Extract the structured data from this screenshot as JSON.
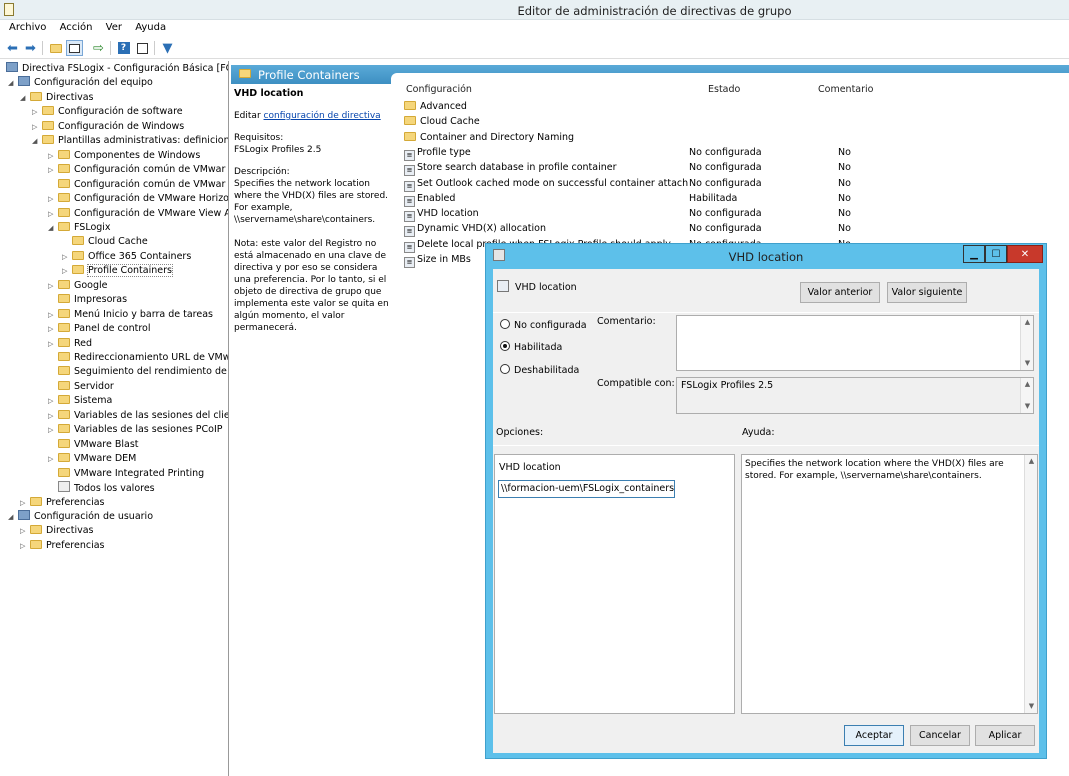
{
  "window": {
    "title": "Editor de administración de directivas de grupo"
  },
  "menu": [
    "Archivo",
    "Acción",
    "Ver",
    "Ayuda"
  ],
  "toolbar_icons": [
    "back-icon",
    "forward-icon",
    "up-folder-icon",
    "show-hide-tree-icon",
    "export-list-icon",
    "help-icon",
    "properties-icon",
    "filter-icon"
  ],
  "tree": [
    {
      "label": "Directiva FSLogix - Configuración Básica [FORM",
      "icon": "policy",
      "level": 0,
      "exp": ""
    },
    {
      "label": "Configuración del equipo",
      "icon": "computer",
      "level": 1,
      "exp": "◢"
    },
    {
      "label": "Directivas",
      "icon": "folder",
      "level": 2,
      "exp": "◢"
    },
    {
      "label": "Configuración de software",
      "icon": "folder",
      "level": 3,
      "exp": "▷"
    },
    {
      "label": "Configuración de Windows",
      "icon": "folder",
      "level": 3,
      "exp": "▷"
    },
    {
      "label": "Plantillas administrativas: definicione",
      "icon": "folder",
      "level": 3,
      "exp": "◢"
    },
    {
      "label": "Componentes de Windows",
      "icon": "folder",
      "level": 4,
      "exp": "▷"
    },
    {
      "label": "Configuración común de VMwar",
      "icon": "folder",
      "level": 4,
      "exp": "▷"
    },
    {
      "label": "Configuración común de VMwar",
      "icon": "folder",
      "level": 4,
      "exp": ""
    },
    {
      "label": "Configuración de VMware Horizo",
      "icon": "folder",
      "level": 4,
      "exp": "▷"
    },
    {
      "label": "Configuración de VMware View A",
      "icon": "folder",
      "level": 4,
      "exp": "▷"
    },
    {
      "label": "FSLogix",
      "icon": "folder",
      "level": 4,
      "exp": "◢"
    },
    {
      "label": "Cloud Cache",
      "icon": "folder",
      "level": 5,
      "exp": ""
    },
    {
      "label": "Office 365 Containers",
      "icon": "folder",
      "level": 5,
      "exp": "▷"
    },
    {
      "label": "Profile Containers",
      "icon": "folder",
      "level": 5,
      "exp": "▷",
      "selected": true
    },
    {
      "label": "Google",
      "icon": "folder",
      "level": 4,
      "exp": "▷"
    },
    {
      "label": "Impresoras",
      "icon": "folder",
      "level": 4,
      "exp": ""
    },
    {
      "label": "Menú Inicio y barra de tareas",
      "icon": "folder",
      "level": 4,
      "exp": "▷"
    },
    {
      "label": "Panel de control",
      "icon": "folder",
      "level": 4,
      "exp": "▷"
    },
    {
      "label": "Red",
      "icon": "folder",
      "level": 4,
      "exp": "▷"
    },
    {
      "label": "Redireccionamiento URL de VMw",
      "icon": "folder",
      "level": 4,
      "exp": ""
    },
    {
      "label": "Seguimiento del rendimiento de V",
      "icon": "folder",
      "level": 4,
      "exp": ""
    },
    {
      "label": "Servidor",
      "icon": "folder",
      "level": 4,
      "exp": ""
    },
    {
      "label": "Sistema",
      "icon": "folder",
      "level": 4,
      "exp": "▷"
    },
    {
      "label": "Variables de las sesiones del client",
      "icon": "folder",
      "level": 4,
      "exp": "▷"
    },
    {
      "label": "Variables de las sesiones PCoIP",
      "icon": "folder",
      "level": 4,
      "exp": "▷"
    },
    {
      "label": "VMware Blast",
      "icon": "folder",
      "level": 4,
      "exp": ""
    },
    {
      "label": "VMware DEM",
      "icon": "folder",
      "level": 4,
      "exp": "▷"
    },
    {
      "label": "VMware Integrated Printing",
      "icon": "folder",
      "level": 4,
      "exp": ""
    },
    {
      "label": "Todos los valores",
      "icon": "all",
      "level": 4,
      "exp": ""
    },
    {
      "label": "Preferencias",
      "icon": "folder",
      "level": 2,
      "exp": "▷"
    },
    {
      "label": "Configuración de usuario",
      "icon": "user",
      "level": 1,
      "exp": "◢"
    },
    {
      "label": "Directivas",
      "icon": "folder",
      "level": 2,
      "exp": "▷"
    },
    {
      "label": "Preferencias",
      "icon": "folder",
      "level": 2,
      "exp": "▷"
    }
  ],
  "pane": {
    "header": "Profile Containers",
    "desc_title": "VHD location",
    "edit_prefix": "Editar",
    "edit_link": "configuración de directiva",
    "req_label": "Requisitos:",
    "req_value": "FSLogix Profiles 2.5",
    "desc_label": "Descripción:",
    "desc_text": "Specifies the network location where the VHD(X) files are stored. For example, \\\\servername\\share\\containers.",
    "note": "Nota: este valor del Registro no está almacenado en una clave de directiva y por eso se considera una preferencia. Por lo tanto, si el objeto de directiva de grupo que implementa este valor se quita en algún momento, el valor permanecerá.",
    "columns": {
      "setting": "Configuración",
      "state": "Estado",
      "comment": "Comentario"
    },
    "items": [
      {
        "name": "Advanced",
        "type": "folder",
        "state": "",
        "comment": ""
      },
      {
        "name": "Cloud Cache",
        "type": "folder",
        "state": "",
        "comment": ""
      },
      {
        "name": "Container and Directory Naming",
        "type": "folder",
        "state": "",
        "comment": ""
      },
      {
        "name": "Profile type",
        "type": "setting",
        "state": "No configurada",
        "comment": "No"
      },
      {
        "name": "Store search database in profile container",
        "type": "setting",
        "state": "No configurada",
        "comment": "No"
      },
      {
        "name": "Set Outlook cached mode on successful container attach",
        "type": "setting",
        "state": "No configurada",
        "comment": "No"
      },
      {
        "name": "Enabled",
        "type": "setting",
        "state": "Habilitada",
        "comment": "No"
      },
      {
        "name": "VHD location",
        "type": "setting",
        "state": "No configurada",
        "comment": "No"
      },
      {
        "name": "Dynamic VHD(X) allocation",
        "type": "setting",
        "state": "No configurada",
        "comment": "No"
      },
      {
        "name": "Delete local profile when FSLogix Profile should apply",
        "type": "setting",
        "state": "No configurada",
        "comment": "No"
      },
      {
        "name": "Size in MBs",
        "type": "setting",
        "state": "",
        "comment": ""
      }
    ]
  },
  "dialog": {
    "title": "VHD location",
    "setting_name": "VHD location",
    "prev_button": "Valor anterior",
    "next_button": "Valor siguiente",
    "radio_not_configured": "No configurada",
    "radio_enabled": "Habilitada",
    "radio_disabled": "Deshabilitada",
    "comment_label": "Comentario:",
    "comment_value": "",
    "supported_label": "Compatible con:",
    "supported_value": "FSLogix Profiles 2.5",
    "options_label": "Opciones:",
    "help_label": "Ayuda:",
    "option_field_label": "VHD location",
    "option_field_value": "\\\\formacion-uem\\FSLogix_containers",
    "help_text": "Specifies the network location where the VHD(X) files are stored. For example, \\\\servername\\share\\containers.",
    "ok_button": "Aceptar",
    "cancel_button": "Cancelar",
    "apply_button": "Aplicar"
  }
}
